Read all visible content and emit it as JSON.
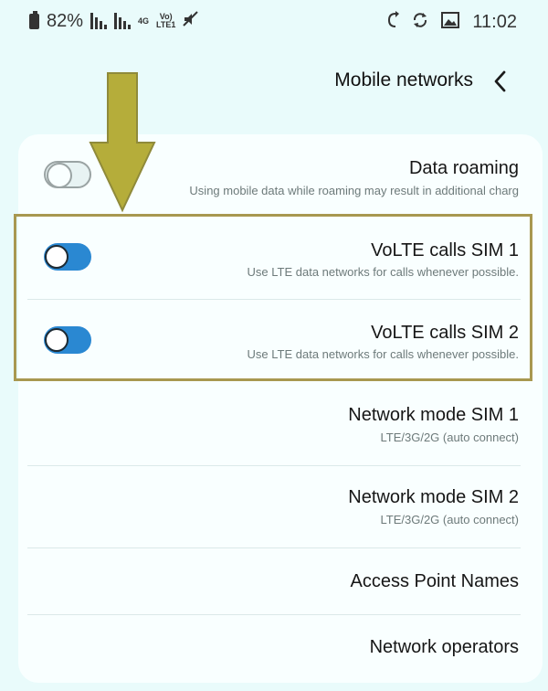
{
  "status_bar": {
    "battery_percent": "82%",
    "net_type": "4G",
    "volte_label_top": "Vo)",
    "volte_label_bottom": "LTE1",
    "time": "11:02"
  },
  "header": {
    "title": "Mobile networks"
  },
  "settings": {
    "data_roaming": {
      "title": "Data roaming",
      "subtitle": "Using mobile data while roaming may result in additional charg",
      "enabled": false
    },
    "volte_sim1": {
      "title": "VoLTE calls SIM 1",
      "subtitle": "Use LTE data networks for calls whenever possible.",
      "enabled": true
    },
    "volte_sim2": {
      "title": "VoLTE calls SIM 2",
      "subtitle": "Use LTE data networks for calls whenever possible.",
      "enabled": true
    },
    "network_mode_sim1": {
      "title": "Network mode SIM 1",
      "subtitle": "LTE/3G/2G (auto connect)"
    },
    "network_mode_sim2": {
      "title": "Network mode SIM 2",
      "subtitle": "LTE/3G/2G (auto connect)"
    },
    "access_point_names": {
      "title": "Access Point Names"
    },
    "network_operators": {
      "title": "Network operators"
    }
  },
  "annotation": {
    "arrow_color": "#b5ad3a",
    "box_color": "#a89850"
  }
}
